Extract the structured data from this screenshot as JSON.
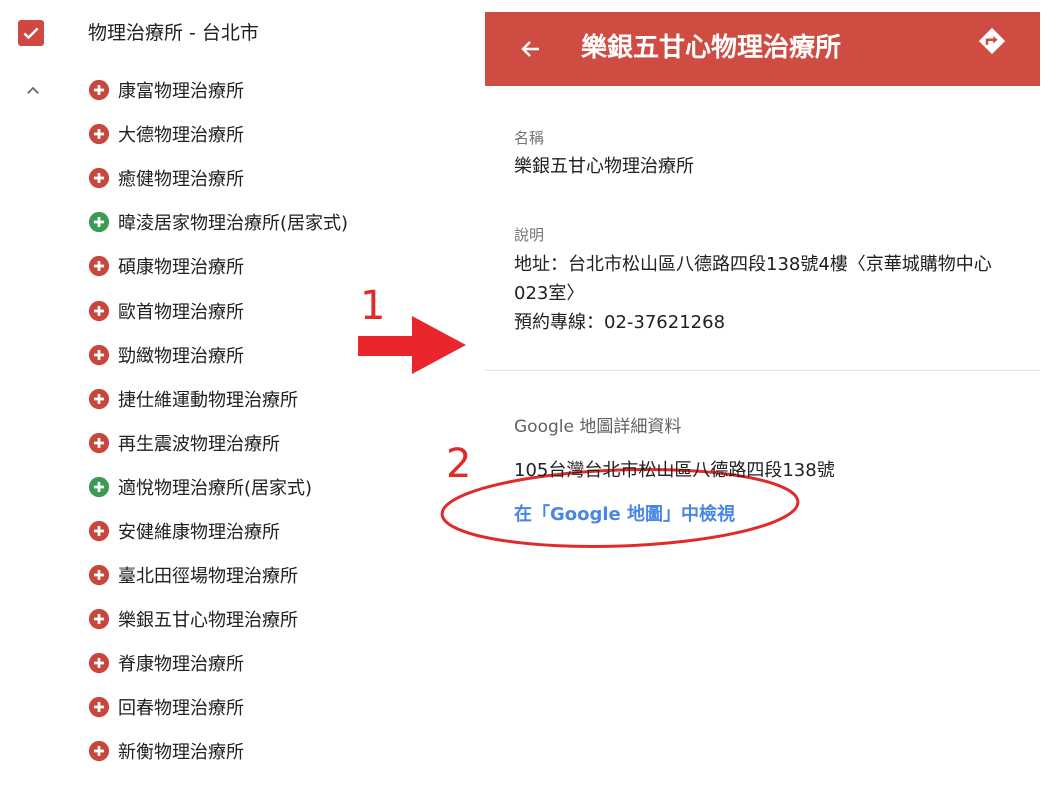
{
  "layer": {
    "title": "物理治療所 - 台北市",
    "checked": true,
    "icon": "check-icon",
    "collapse_icon": "chevron-up-icon"
  },
  "places": [
    {
      "name": "康富物理治療所",
      "pin": "red"
    },
    {
      "name": "大德物理治療所",
      "pin": "red"
    },
    {
      "name": "癒健物理治療所",
      "pin": "red"
    },
    {
      "name": "暐淩居家物理治療所(居家式)",
      "pin": "green"
    },
    {
      "name": "碩康物理治療所",
      "pin": "red"
    },
    {
      "name": "歐首物理治療所",
      "pin": "red"
    },
    {
      "name": "勁緻物理治療所",
      "pin": "red"
    },
    {
      "name": "捷仕維運動物理治療所",
      "pin": "red"
    },
    {
      "name": "再生震波物理治療所",
      "pin": "red"
    },
    {
      "name": "適悅物理治療所(居家式)",
      "pin": "green"
    },
    {
      "name": "安健維康物理治療所",
      "pin": "red"
    },
    {
      "name": "臺北田徑場物理治療所",
      "pin": "red"
    },
    {
      "name": "樂銀五甘心物理治療所",
      "pin": "red"
    },
    {
      "name": "脊康物理治療所",
      "pin": "red"
    },
    {
      "name": "回春物理治療所",
      "pin": "red"
    },
    {
      "name": "新衡物理治療所",
      "pin": "red"
    }
  ],
  "colors": {
    "header_bg": "#cf4c42",
    "pin_red": "#c9463d",
    "pin_green": "#3d9a52",
    "link": "#4a86e8",
    "annotation": "#e12a2a"
  },
  "detail": {
    "title": "樂銀五甘心物理治療所",
    "back_icon": "arrow-left-icon",
    "directions_icon": "directions-icon",
    "name_label": "名稱",
    "name_value": "樂銀五甘心物理治療所",
    "desc_label": "說明",
    "desc_line1": "地址：台北市松山區八德路四段138號4樓〈京華城購物中心023室〉",
    "desc_line2": "預約專線：02-37621268",
    "gmaps_label": "Google 地圖詳細資料",
    "gmaps_address": "105台灣台北市松山區八德路四段138號",
    "gmaps_link": "在「Google 地圖」中檢視"
  },
  "annotations": {
    "step1": "1",
    "step2": "2"
  }
}
